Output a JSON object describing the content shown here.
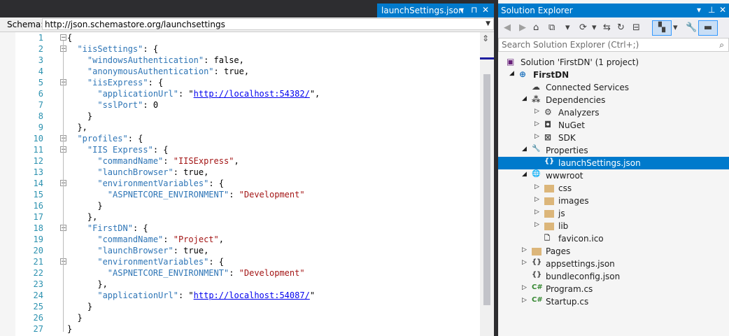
{
  "editor": {
    "tab_title": "launchSettings.json",
    "schema_label": "Schema:",
    "schema_url": "http://json.schemastore.org/launchsettings",
    "lines": [
      {
        "n": "1",
        "c": [
          [
            "p",
            "{"
          ]
        ]
      },
      {
        "n": "2",
        "c": [
          [
            "p",
            "  "
          ],
          [
            "k",
            "\"iisSettings\""
          ],
          [
            "p",
            ": {"
          ]
        ]
      },
      {
        "n": "3",
        "c": [
          [
            "p",
            "    "
          ],
          [
            "k",
            "\"windowsAuthentication\""
          ],
          [
            "p",
            ": "
          ],
          [
            "p",
            "false"
          ],
          [
            "p",
            ","
          ]
        ]
      },
      {
        "n": "4",
        "c": [
          [
            "p",
            "    "
          ],
          [
            "k",
            "\"anonymousAuthentication\""
          ],
          [
            "p",
            ": true,"
          ]
        ]
      },
      {
        "n": "5",
        "c": [
          [
            "p",
            "    "
          ],
          [
            "k",
            "\"iisExpress\""
          ],
          [
            "p",
            ": {"
          ]
        ]
      },
      {
        "n": "6",
        "c": [
          [
            "p",
            "      "
          ],
          [
            "k",
            "\"applicationUrl\""
          ],
          [
            "p",
            ": \""
          ],
          [
            "u",
            "http://localhost:54382/"
          ],
          [
            "p",
            "\","
          ]
        ]
      },
      {
        "n": "7",
        "c": [
          [
            "p",
            "      "
          ],
          [
            "k",
            "\"sslPort\""
          ],
          [
            "p",
            ": 0"
          ]
        ]
      },
      {
        "n": "8",
        "c": [
          [
            "p",
            "    }"
          ]
        ]
      },
      {
        "n": "9",
        "c": [
          [
            "p",
            "  },"
          ]
        ]
      },
      {
        "n": "10",
        "c": [
          [
            "p",
            "  "
          ],
          [
            "k",
            "\"profiles\""
          ],
          [
            "p",
            ": {"
          ]
        ]
      },
      {
        "n": "11",
        "c": [
          [
            "p",
            "    "
          ],
          [
            "k",
            "\"IIS Express\""
          ],
          [
            "p",
            ": {"
          ]
        ]
      },
      {
        "n": "12",
        "c": [
          [
            "p",
            "      "
          ],
          [
            "k",
            "\"commandName\""
          ],
          [
            "p",
            ": "
          ],
          [
            "s",
            "\"IISExpress\""
          ],
          [
            "p",
            ","
          ]
        ]
      },
      {
        "n": "13",
        "c": [
          [
            "p",
            "      "
          ],
          [
            "k",
            "\"launchBrowser\""
          ],
          [
            "p",
            ": true,"
          ]
        ]
      },
      {
        "n": "14",
        "c": [
          [
            "p",
            "      "
          ],
          [
            "k",
            "\"environmentVariables\""
          ],
          [
            "p",
            ": {"
          ]
        ]
      },
      {
        "n": "15",
        "c": [
          [
            "p",
            "        "
          ],
          [
            "k",
            "\"ASPNETCORE_ENVIRONMENT\""
          ],
          [
            "p",
            ": "
          ],
          [
            "s",
            "\"Development\""
          ]
        ]
      },
      {
        "n": "16",
        "c": [
          [
            "p",
            "      }"
          ]
        ]
      },
      {
        "n": "17",
        "c": [
          [
            "p",
            "    },"
          ]
        ]
      },
      {
        "n": "18",
        "c": [
          [
            "p",
            "    "
          ],
          [
            "k",
            "\"FirstDN\""
          ],
          [
            "p",
            ": {"
          ]
        ]
      },
      {
        "n": "19",
        "c": [
          [
            "p",
            "      "
          ],
          [
            "k",
            "\"commandName\""
          ],
          [
            "p",
            ": "
          ],
          [
            "s",
            "\"Project\""
          ],
          [
            "p",
            ","
          ]
        ]
      },
      {
        "n": "20",
        "c": [
          [
            "p",
            "      "
          ],
          [
            "k",
            "\"launchBrowser\""
          ],
          [
            "p",
            ": true,"
          ]
        ]
      },
      {
        "n": "21",
        "c": [
          [
            "p",
            "      "
          ],
          [
            "k",
            "\"environmentVariables\""
          ],
          [
            "p",
            ": {"
          ]
        ]
      },
      {
        "n": "22",
        "c": [
          [
            "p",
            "        "
          ],
          [
            "k",
            "\"ASPNETCORE_ENVIRONMENT\""
          ],
          [
            "p",
            ": "
          ],
          [
            "s",
            "\"Development\""
          ]
        ]
      },
      {
        "n": "23",
        "c": [
          [
            "p",
            "      },"
          ]
        ]
      },
      {
        "n": "24",
        "c": [
          [
            "p",
            "      "
          ],
          [
            "k",
            "\"applicationUrl\""
          ],
          [
            "p",
            ": \""
          ],
          [
            "u",
            "http://localhost:54087/"
          ],
          [
            "p",
            "\""
          ]
        ]
      },
      {
        "n": "25",
        "c": [
          [
            "p",
            "    }"
          ]
        ]
      },
      {
        "n": "26",
        "c": [
          [
            "p",
            "  }"
          ]
        ]
      },
      {
        "n": "27",
        "c": [
          [
            "p",
            "}"
          ]
        ]
      }
    ]
  },
  "solution_explorer": {
    "title": "Solution Explorer",
    "search_placeholder": "Search Solution Explorer (Ctrl+;)",
    "items": [
      {
        "label": "Solution 'FirstDN' (1 project)",
        "depth": 0,
        "arrow": "",
        "icon": "solution-icon",
        "glyph": "▣",
        "color": "#68217a"
      },
      {
        "label": "FirstDN",
        "depth": 1,
        "arrow": "◢",
        "icon": "web-project-icon",
        "glyph": "⊕",
        "color": "#1e73be",
        "bold": true
      },
      {
        "label": "Connected Services",
        "depth": 2,
        "arrow": "",
        "icon": "connected-services-icon",
        "glyph": "☁",
        "color": "#424242"
      },
      {
        "label": "Dependencies",
        "depth": 2,
        "arrow": "◢",
        "icon": "dependencies-icon",
        "glyph": "⁂",
        "color": "#424242"
      },
      {
        "label": "Analyzers",
        "depth": 3,
        "arrow": "▷",
        "icon": "analyzers-icon",
        "glyph": "⚙",
        "color": "#424242"
      },
      {
        "label": "NuGet",
        "depth": 3,
        "arrow": "▷",
        "icon": "nuget-icon",
        "glyph": "◘",
        "color": "#424242"
      },
      {
        "label": "SDK",
        "depth": 3,
        "arrow": "▷",
        "icon": "sdk-icon",
        "glyph": "⊠",
        "color": "#424242"
      },
      {
        "label": "Properties",
        "depth": 2,
        "arrow": "◢",
        "icon": "wrench-icon",
        "glyph": "🔧",
        "color": "#424242"
      },
      {
        "label": "launchSettings.json",
        "depth": 3,
        "arrow": "",
        "icon": "json-file-icon",
        "glyph": "{}",
        "color": "#ffffff",
        "selected": true
      },
      {
        "label": "wwwroot",
        "depth": 2,
        "arrow": "◢",
        "icon": "globe-icon",
        "glyph": "🌐",
        "color": "#424242"
      },
      {
        "label": "css",
        "depth": 3,
        "arrow": "▷",
        "icon": "folder-icon",
        "folder": true
      },
      {
        "label": "images",
        "depth": 3,
        "arrow": "▷",
        "icon": "folder-icon",
        "folder": true
      },
      {
        "label": "js",
        "depth": 3,
        "arrow": "▷",
        "icon": "folder-icon",
        "folder": true
      },
      {
        "label": "lib",
        "depth": 3,
        "arrow": "▷",
        "icon": "folder-icon",
        "folder": true
      },
      {
        "label": "favicon.ico",
        "depth": 3,
        "arrow": "",
        "icon": "file-icon",
        "glyph": "🗋",
        "color": "#424242"
      },
      {
        "label": "Pages",
        "depth": 2,
        "arrow": "▷",
        "icon": "folder-icon",
        "folder": true
      },
      {
        "label": "appsettings.json",
        "depth": 2,
        "arrow": "▷",
        "icon": "json-file-icon",
        "glyph": "{}",
        "color": "#424242"
      },
      {
        "label": "bundleconfig.json",
        "depth": 2,
        "arrow": "",
        "icon": "json-file-icon",
        "glyph": "{}",
        "color": "#424242"
      },
      {
        "label": "Program.cs",
        "depth": 2,
        "arrow": "▷",
        "icon": "csharp-icon",
        "glyph": "C#",
        "color": "#368832"
      },
      {
        "label": "Startup.cs",
        "depth": 2,
        "arrow": "▷",
        "icon": "csharp-icon",
        "glyph": "C#",
        "color": "#368832"
      }
    ]
  },
  "colors": {
    "accent": "#007acc",
    "keyword": "#2e75b6",
    "string": "#a31515",
    "linenum": "#2b91af"
  }
}
